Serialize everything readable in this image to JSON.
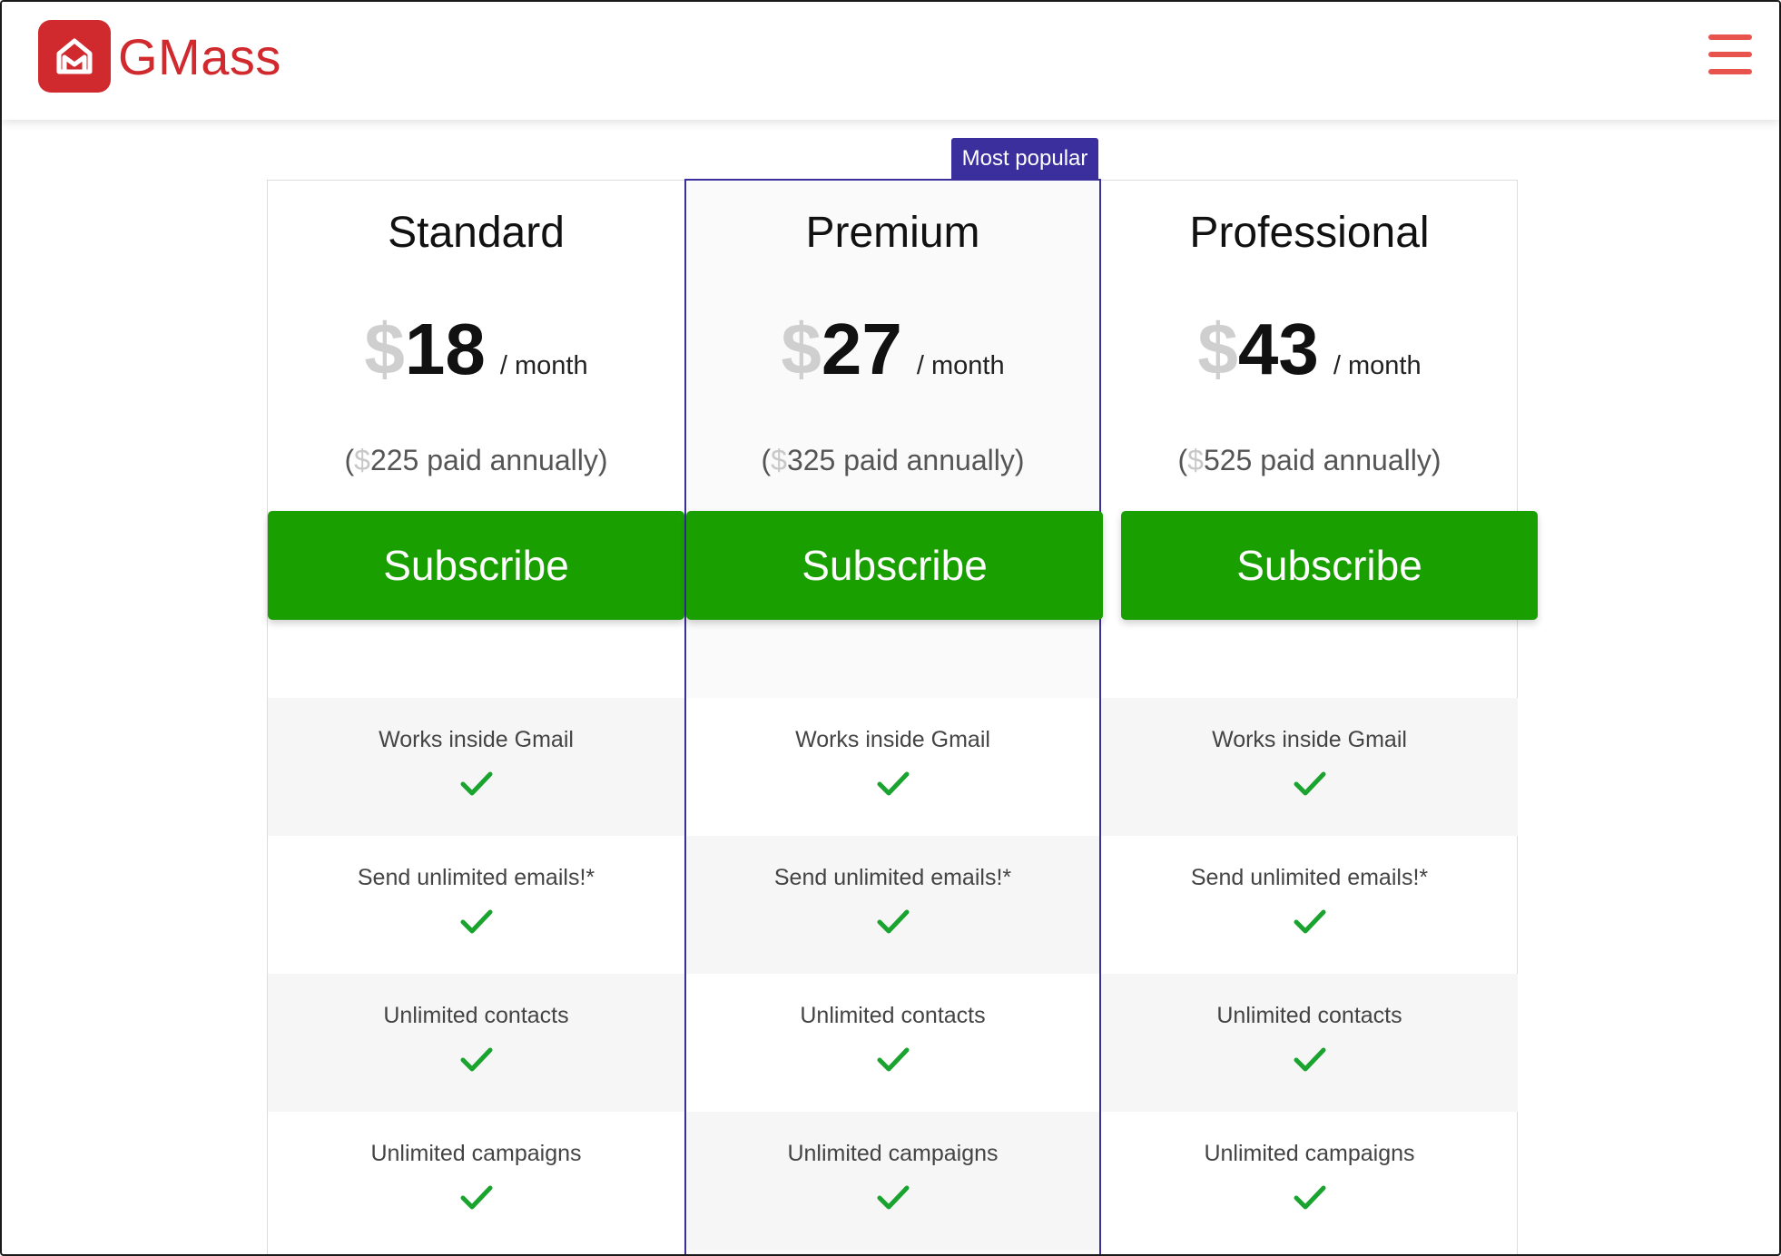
{
  "header": {
    "brand": "GMass",
    "logo_icon": "gmass-logo-icon",
    "menu_icon": "hamburger-menu-icon",
    "brand_color": "#d0292e",
    "menu_color": "#e8534d"
  },
  "badge": {
    "label": "Most popular",
    "color": "#3a2f9d"
  },
  "plans": [
    {
      "name": "Standard",
      "currency": "$",
      "price": "18",
      "period": "/ month",
      "annual_prefix": "(",
      "annual_amount": "225 paid annually)",
      "subscribe": "Subscribe",
      "features": [
        "Works inside Gmail",
        "Send unlimited emails!*",
        "Unlimited contacts",
        "Unlimited campaigns"
      ]
    },
    {
      "name": "Premium",
      "currency": "$",
      "price": "27",
      "period": "/ month",
      "annual_prefix": "(",
      "annual_amount": "325 paid annually)",
      "subscribe": "Subscribe",
      "features": [
        "Works inside Gmail",
        "Send unlimited emails!*",
        "Unlimited contacts",
        "Unlimited campaigns"
      ]
    },
    {
      "name": "Professional",
      "currency": "$",
      "price": "43",
      "period": "/ month",
      "annual_prefix": "(",
      "annual_amount": "525 paid annually)",
      "subscribe": "Subscribe",
      "features": [
        "Works inside Gmail",
        "Send unlimited emails!*",
        "Unlimited contacts",
        "Unlimited campaigns"
      ]
    }
  ],
  "colors": {
    "subscribe_bg": "#19a000",
    "check": "#1aa32e",
    "popular_border": "#3a2f9d"
  },
  "icons": {
    "feature_check": "checkmark-icon"
  }
}
